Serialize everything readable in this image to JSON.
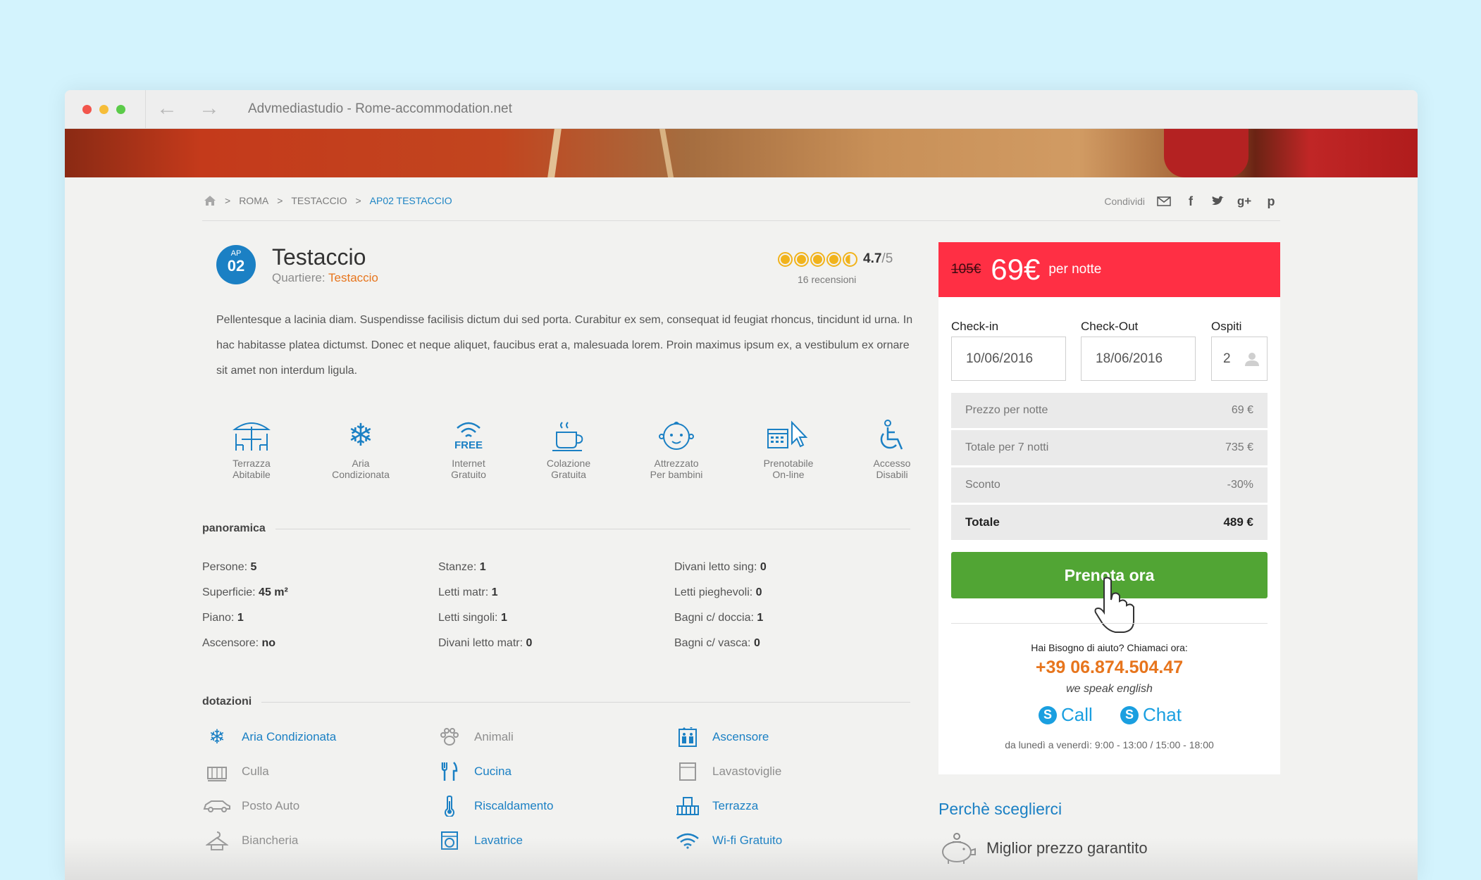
{
  "browser": {
    "title": "Advmediastudio - Rome-accommodation.net"
  },
  "breadcrumb": {
    "items": [
      "ROMA",
      "TESTACCIO"
    ],
    "active": "AP02 TESTACCIO",
    "sep": ">"
  },
  "share": {
    "label": "Condividi"
  },
  "listing": {
    "badge_small": "AP",
    "badge_number": "02",
    "title": "Testaccio",
    "district_label": "Quartiere:",
    "district": "Testaccio",
    "rating": "4.7",
    "rating_max": "/5",
    "reviews": "16 recensioni",
    "description": "Pellentesque a lacinia diam. Suspendisse facilisis dictum dui sed porta. Curabitur ex sem, consequat id feugiat rhoncus, tincidunt id urna. In hac habitasse platea dictumst. Donec et neque aliquet, faucibus erat a, malesuada lorem. Proin maximus ipsum ex, a vestibulum ex ornare sit amet non interdum ligula."
  },
  "amenities": [
    {
      "l1": "Terrazza",
      "l2": "Abitabile"
    },
    {
      "l1": "Aria",
      "l2": "Condizionata"
    },
    {
      "l1": "Internet",
      "l2": "Gratuito",
      "tag": "FREE"
    },
    {
      "l1": "Colazione",
      "l2": "Gratuita"
    },
    {
      "l1": "Attrezzato",
      "l2": "Per bambini"
    },
    {
      "l1": "Prenotabile",
      "l2": "On-line"
    },
    {
      "l1": "Accesso",
      "l2": "Disabili"
    }
  ],
  "overview": {
    "heading": "panoramica",
    "col1": [
      {
        "k": "Persone:",
        "v": "5"
      },
      {
        "k": "Superficie:",
        "v": "45 m²"
      },
      {
        "k": "Piano:",
        "v": "1"
      },
      {
        "k": "Ascensore:",
        "v": "no"
      }
    ],
    "col2": [
      {
        "k": "Stanze:",
        "v": "1"
      },
      {
        "k": "Letti matr:",
        "v": "1"
      },
      {
        "k": "Letti singoli:",
        "v": "1"
      },
      {
        "k": "Divani letto matr:",
        "v": "0"
      }
    ],
    "col3": [
      {
        "k": "Divani letto sing:",
        "v": "0"
      },
      {
        "k": "Letti pieghevoli:",
        "v": "0"
      },
      {
        "k": "Bagni c/ doccia:",
        "v": "1"
      },
      {
        "k": "Bagni c/ vasca:",
        "v": "0"
      }
    ]
  },
  "equipment": {
    "heading": "dotazioni",
    "col1": [
      {
        "label": "Aria Condizionata",
        "on": true,
        "icon": "snowflake-icon"
      },
      {
        "label": "Culla",
        "on": false,
        "icon": "crib-icon"
      },
      {
        "label": "Posto Auto",
        "on": false,
        "icon": "car-icon"
      },
      {
        "label": "Biancheria",
        "on": false,
        "icon": "hanger-icon"
      }
    ],
    "col2": [
      {
        "label": "Animali",
        "on": false,
        "icon": "paw-icon"
      },
      {
        "label": "Cucina",
        "on": true,
        "icon": "cutlery-icon"
      },
      {
        "label": "Riscaldamento",
        "on": true,
        "icon": "thermometer-icon"
      },
      {
        "label": "Lavatrice",
        "on": true,
        "icon": "washing-machine-icon"
      }
    ],
    "col3": [
      {
        "label": "Ascensore",
        "on": true,
        "icon": "elevator-icon"
      },
      {
        "label": "Lavastoviglie",
        "on": false,
        "icon": "dishwasher-icon"
      },
      {
        "label": "Terrazza",
        "on": true,
        "icon": "terrace-icon"
      },
      {
        "label": "Wi-fi Gratuito",
        "on": true,
        "icon": "wifi-icon"
      }
    ]
  },
  "booking": {
    "old_price": "105€",
    "price": "69€",
    "per": "per notte",
    "checkin_label": "Check-in",
    "checkin": "10/06/2016",
    "checkout_label": "Check-Out",
    "checkout": "18/06/2016",
    "guests_label": "Ospiti",
    "guests": "2",
    "rows": [
      {
        "k": "Prezzo per notte",
        "v": "69 €"
      },
      {
        "k": "Totale per 7 notti",
        "v": "735 €"
      },
      {
        "k": "Sconto",
        "v": "-30%"
      }
    ],
    "total_label": "Totale",
    "total": "489 €",
    "cta": "Prenota ora",
    "help_q": "Hai Bisogno di aiuto? Chiamaci ora:",
    "phone": "+39 06.874.504.47",
    "english": "we speak english",
    "call": "Call",
    "chat": "Chat",
    "hours": "da lunedì a venerdì: 9:00 - 13:00 / 15:00 - 18:00"
  },
  "why": {
    "title": "Perchè sceglierci",
    "item1": "Miglior prezzo garantito"
  },
  "colors": {
    "accent": "#1b80c4",
    "price": "#ff2f44",
    "cta": "#51a534",
    "phone": "#e7751d"
  }
}
